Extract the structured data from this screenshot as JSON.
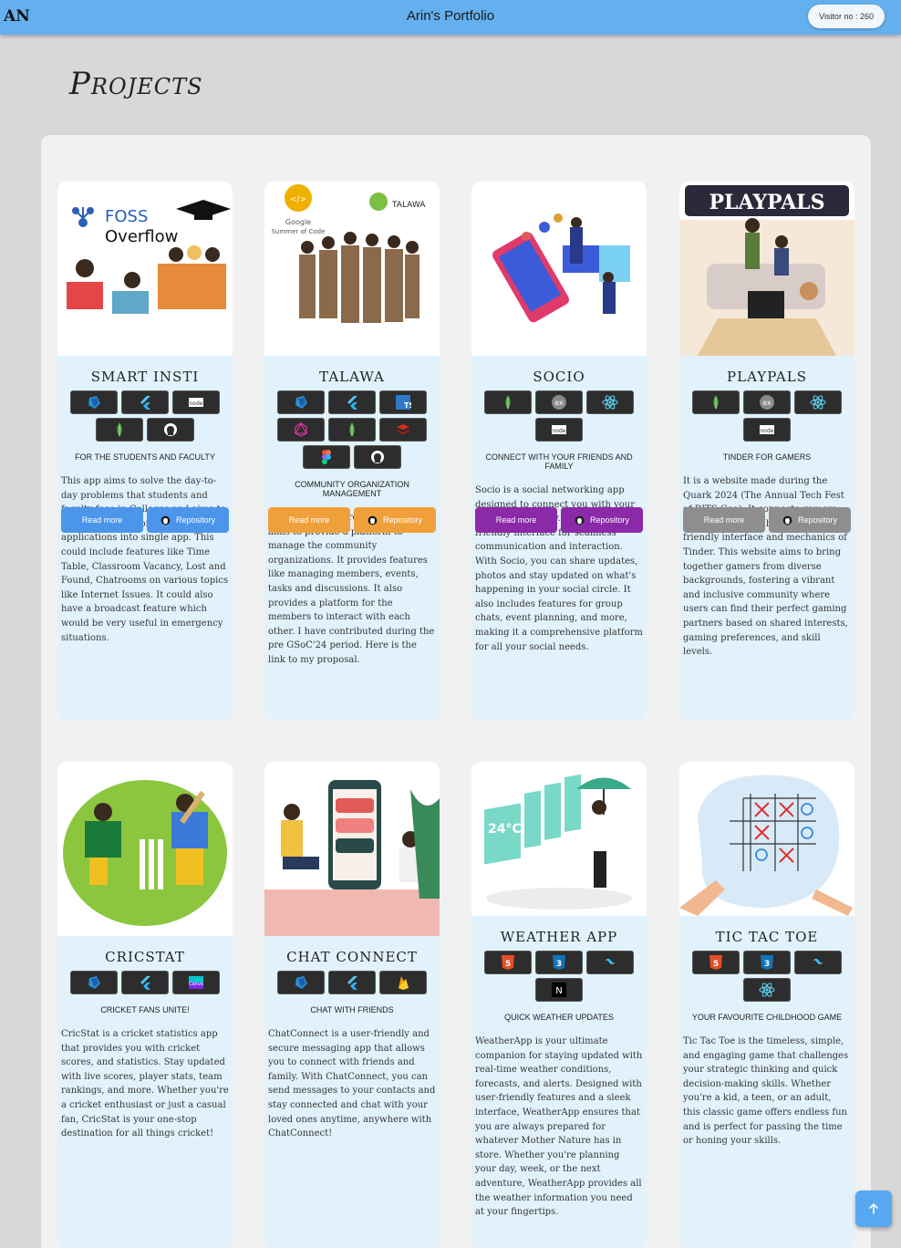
{
  "header": {
    "logo": "AN",
    "title": "Arin's Portfolio",
    "visitor_label": "Visitor no : 260"
  },
  "section_title": "Projects",
  "projects": [
    {
      "title": "SMART INSTI",
      "subtitle": "FOR THE STUDENTS AND FACULTY",
      "tech": [
        "dart",
        "flutter",
        "nodejs",
        "mongodb",
        "github"
      ],
      "image_text": [
        "FOSS",
        "Overflow"
      ],
      "description": "This app aims to solve the day-to-day problems that students and faculty face in Colleges and aims to consolidate a lot of useful applications into single app. This could include features like Time Table, Classroom Vacancy, Lost and Found, Chatrooms on various topics like Internet Issues. It could also have a broadcast feature which would be very useful in emergency situations.",
      "read_more": "Read more",
      "repository": "Repository",
      "color": "#4b96ea"
    },
    {
      "title": "TALAWA",
      "subtitle": "COMMUNITY ORGANIZATION MANAGEMENT",
      "tech": [
        "dart",
        "flutter",
        "typescript",
        "graphql",
        "mongodb",
        "redis",
        "figma",
        "github"
      ],
      "image_text": [
        "Google",
        "Summer of Code",
        "TALAWA"
      ],
      "description": "It is an Open Source Project which aims to provide a platform to manage the community organizations. It provides features like managing members, events, tasks and discussions. It also provides a platform for the members to interact with each other. I have contributed during the pre GSoC'24 period. Here is the link to my proposal.",
      "read_more": "Read more",
      "repository": "Repository",
      "color": "#f0a03a"
    },
    {
      "title": "SOCIO",
      "subtitle": "CONNECT WITH YOUR FRIENDS AND FAMILY",
      "tech": [
        "mongodb",
        "express",
        "react",
        "nodejs"
      ],
      "image_text": [],
      "description": "Socio is a social networking app designed to connect you with your friends and family. It offers a user-friendly interface for seamless communication and interaction. With Socio, you can share updates, photos and stay updated on what's happening in your social circle. It also includes features for group chats, event planning, and more, making it a comprehensive platform for all your social needs.",
      "read_more": "Read more",
      "repository": "Repository",
      "color": "#8a2aa8"
    },
    {
      "title": "PLAYPALS",
      "subtitle": "TINDER FOR GAMERS",
      "tech": [
        "mongodb",
        "express",
        "react",
        "nodejs"
      ],
      "image_text": [
        "PLAYPALS"
      ],
      "description": "It is a website made during the Quark 2024 (The Annual Tech Fest of BITS Goa). It connects gamers around the world having a user-friendly interface and mechanics of Tinder. This website aims to bring together gamers from diverse backgrounds, fostering a vibrant and inclusive community where users can find their perfect gaming partners based on shared interests, gaming preferences, and skill levels.",
      "read_more": "Read more",
      "repository": "Repository",
      "color": "#8e8e8e"
    },
    {
      "title": "CRICSTAT",
      "subtitle": "CRICKET FANS UNITE!",
      "tech": [
        "dart",
        "flutter",
        "canva"
      ],
      "image_text": [],
      "description": "CricStat is a cricket statistics app that provides you with cricket scores, and statistics. Stay updated with live scores, player stats, team rankings, and more. Whether you're a cricket enthusiast or just a casual fan, CricStat is your one-stop destination for all things cricket!",
      "read_more": "Read more",
      "repository": "Repository",
      "color": "#4b96ea"
    },
    {
      "title": "CHAT CONNECT",
      "subtitle": "CHAT WITH FRIENDS",
      "tech": [
        "dart",
        "flutter",
        "firebase"
      ],
      "image_text": [],
      "description": "ChatConnect is a user-friendly and secure messaging app that allows you to connect with friends and family. With ChatConnect, you can send messages to your contacts and stay connected and chat with your loved ones anytime, anywhere with ChatConnect!",
      "read_more": "Read more",
      "repository": "Repository",
      "color": "#4b96ea"
    },
    {
      "title": "WEATHER APP",
      "subtitle": "QUICK WEATHER UPDATES",
      "tech": [
        "html5",
        "css3",
        "tailwind",
        "nextjs"
      ],
      "image_text": [
        "24°C"
      ],
      "description": "WeatherApp is your ultimate companion for staying updated with real-time weather conditions, forecasts, and alerts. Designed with user-friendly features and a sleek interface, WeatherApp ensures that you are always prepared for whatever Mother Nature has in store. Whether you're planning your day, week, or the next adventure, WeatherApp provides all the weather information you need at your fingertips.",
      "read_more": "Read more",
      "repository": "Repository",
      "color": "#4b96ea"
    },
    {
      "title": "TIC TAC TOE",
      "subtitle": "YOUR FAVOURITE CHILDHOOD GAME",
      "tech": [
        "html5",
        "css3",
        "tailwind",
        "react"
      ],
      "image_text": [],
      "description": "Tic Tac Toe is the timeless, simple, and engaging game that challenges your strategic thinking and quick decision-making skills. Whether you're a kid, a teen, or an adult, this classic game offers endless fun and is perfect for passing the time or honing your skills.",
      "read_more": "Read more",
      "repository": "Repository",
      "color": "#4b96ea"
    }
  ],
  "icons": {
    "scroll_top": "arrow-up-icon",
    "repo": "github-icon"
  }
}
